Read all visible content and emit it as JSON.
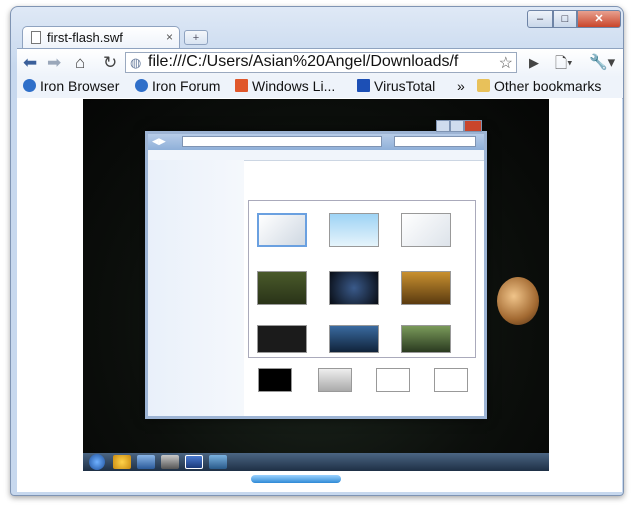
{
  "browser": {
    "tab_title": "first-flash.swf",
    "tab_close": "×",
    "new_tab": "+",
    "window_buttons": {
      "minimize": "–",
      "maximize": "□",
      "close": "✕"
    },
    "url": "file:///C:/Users/Asian%20Angel/Downloads/f",
    "bookmarks": [
      {
        "label": "Iron Browser",
        "icon": "globe-icon",
        "color": "#2f6fc9"
      },
      {
        "label": "Iron Forum",
        "icon": "globe-icon",
        "color": "#2f6fc9"
      },
      {
        "label": "Windows Li...",
        "icon": "windows-flag-icon",
        "color": "#e0572b"
      },
      {
        "label": "VirusTotal",
        "icon": "virustotal-icon",
        "color": "#1c4fb5"
      }
    ],
    "overflow": "»",
    "other_bookmarks": "Other bookmarks"
  },
  "colors": {
    "chrome_frame": "#c7d8ee",
    "flash_bg": "#0c0f0c",
    "close_red": "#c9452b"
  }
}
